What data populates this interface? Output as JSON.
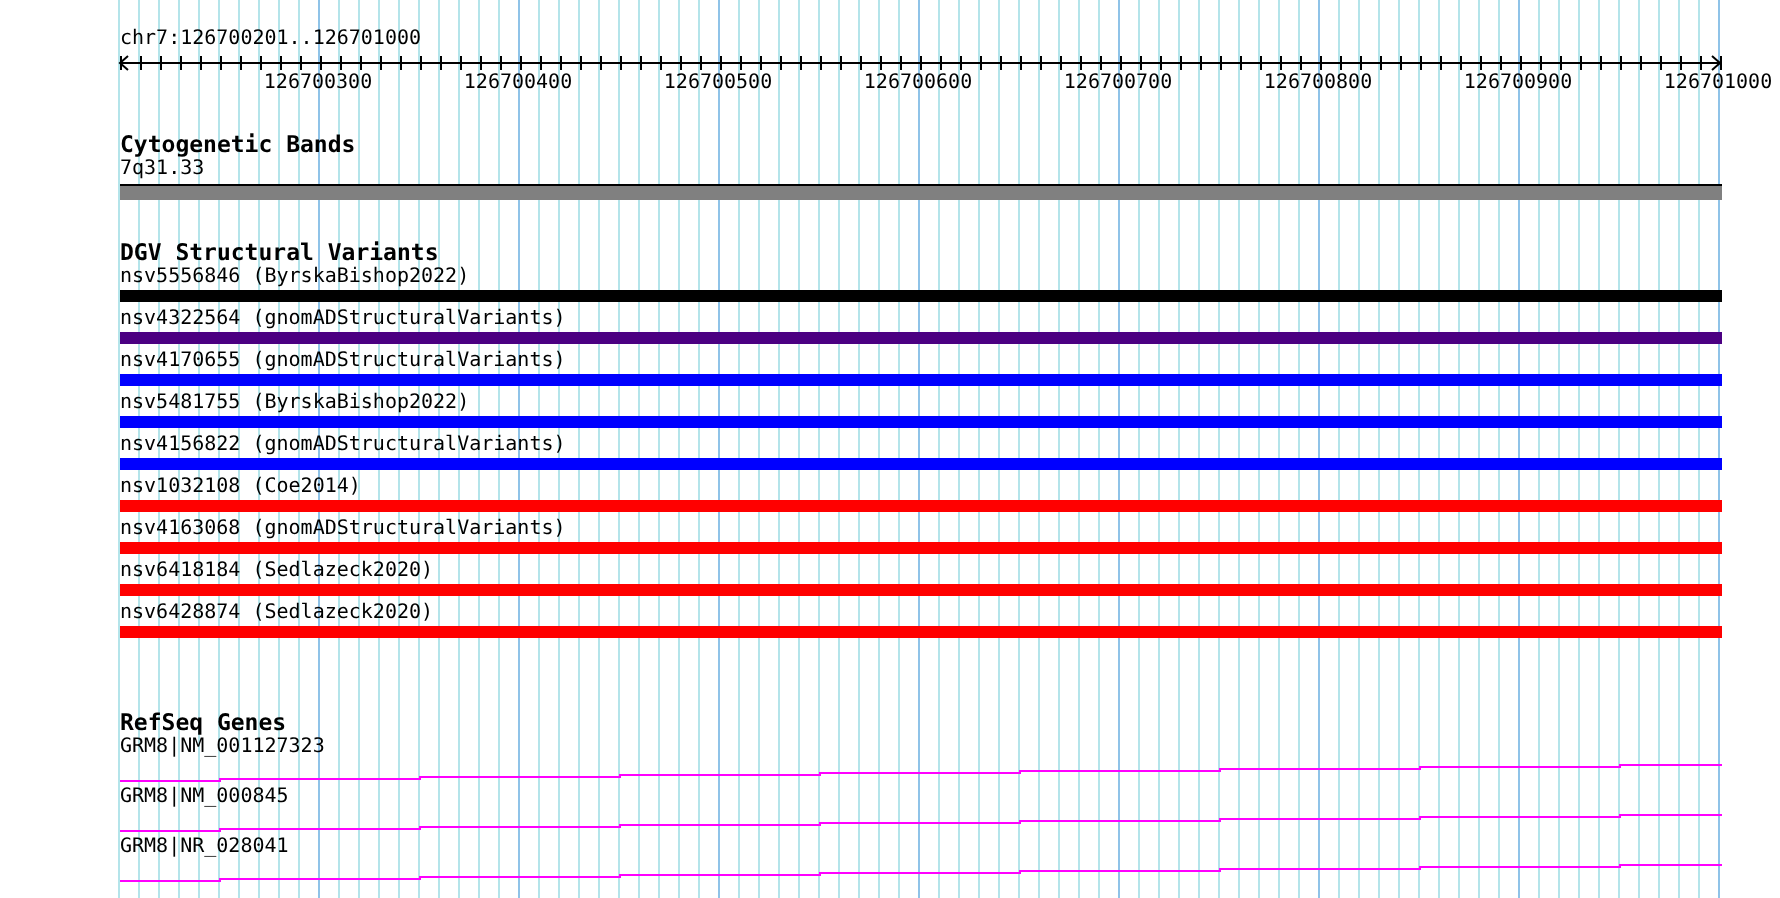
{
  "location": "chr7:126700201..126701000",
  "ruler": {
    "tick_labels": [
      "126700300",
      "126700400",
      "126700500",
      "126700600",
      "126700700",
      "126700800",
      "126700900",
      "126701000"
    ]
  },
  "tracks": [
    {
      "kind": "bands",
      "title": "Cytogenetic Bands",
      "features": [
        {
          "label": "7q31.33"
        }
      ]
    },
    {
      "kind": "variants",
      "title": "DGV Structural Variants",
      "features": [
        {
          "label": "nsv5556846 (ByrskaBishop2022)",
          "color": "#000000"
        },
        {
          "label": "nsv4322564 (gnomADStructuralVariants)",
          "color": "#4b0082"
        },
        {
          "label": "nsv4170655 (gnomADStructuralVariants)",
          "color": "#0000ff"
        },
        {
          "label": "nsv5481755 (ByrskaBishop2022)",
          "color": "#0000ff"
        },
        {
          "label": "nsv4156822 (gnomADStructuralVariants)",
          "color": "#0000ff"
        },
        {
          "label": "nsv1032108 (Coe2014)",
          "color": "#ff0000"
        },
        {
          "label": "nsv4163068 (gnomADStructuralVariants)",
          "color": "#ff0000"
        },
        {
          "label": "nsv6418184 (Sedlazeck2020)",
          "color": "#ff0000"
        },
        {
          "label": "nsv6428874 (Sedlazeck2020)",
          "color": "#ff0000"
        }
      ]
    },
    {
      "kind": "genes",
      "title": "RefSeq Genes",
      "features": [
        {
          "label": "GRM8|NM_001127323"
        },
        {
          "label": "GRM8|NM_000845"
        },
        {
          "label": "GRM8|NR_028041"
        }
      ]
    }
  ]
}
